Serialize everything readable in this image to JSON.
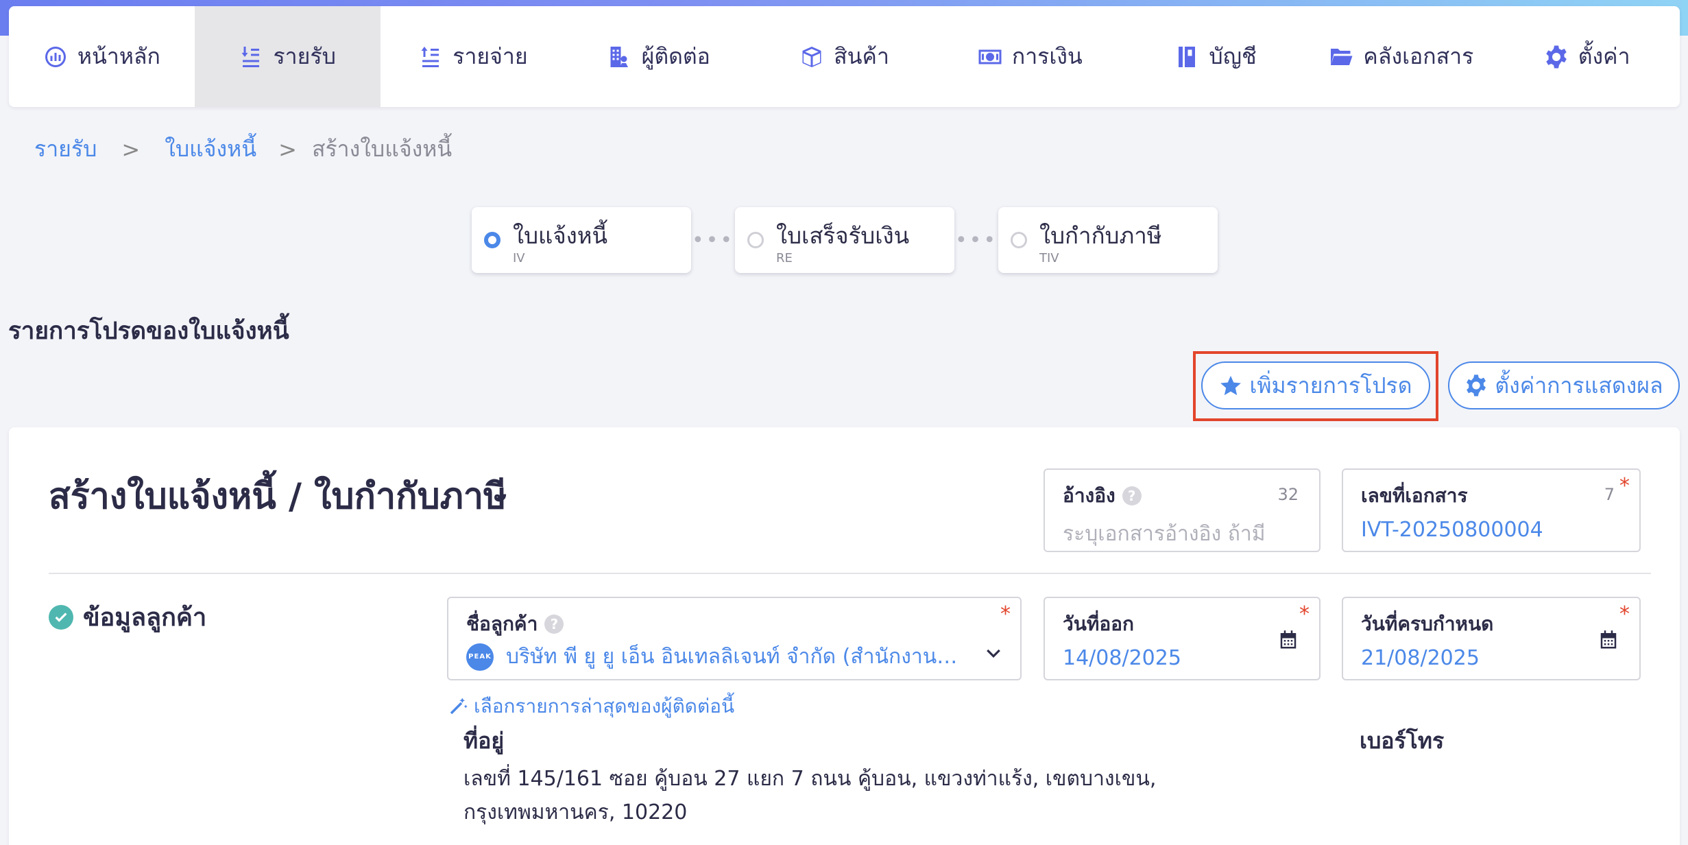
{
  "nav": {
    "items": [
      {
        "label": "หน้าหลัก",
        "icon": "dashboard-icon"
      },
      {
        "label": "รายรับ",
        "icon": "income-icon"
      },
      {
        "label": "รายจ่าย",
        "icon": "expense-icon"
      },
      {
        "label": "ผู้ติดต่อ",
        "icon": "contacts-icon"
      },
      {
        "label": "สินค้า",
        "icon": "box-icon"
      },
      {
        "label": "การเงิน",
        "icon": "money-icon"
      },
      {
        "label": "บัญชี",
        "icon": "ledger-icon"
      },
      {
        "label": "คลังเอกสาร",
        "icon": "folder-icon"
      },
      {
        "label": "ตั้งค่า",
        "icon": "gear-icon"
      }
    ],
    "active_index": 1
  },
  "breadcrumb": {
    "level1": "รายรับ",
    "level2": "ใบแจ้งหนี้",
    "current": "สร้างใบแจ้งหนี้",
    "separator": ">"
  },
  "steps": [
    {
      "title": "ใบแจ้งหนี้",
      "code": "IV"
    },
    {
      "title": "ใบเสร็จรับเงิน",
      "code": "RE"
    },
    {
      "title": "ใบกำกับภาษี",
      "code": "TIV"
    }
  ],
  "favorites": {
    "title": "รายการโปรดของใบแจ้งหนี้",
    "add_button": "เพิ่มรายการโปรด",
    "display_settings_button": "ตั้งค่าการแสดงผล"
  },
  "form": {
    "title": "สร้างใบแจ้งหนี้ / ใบกำกับภาษี",
    "reference": {
      "label": "อ้างอิง",
      "counter": "32",
      "placeholder": "ระบุเอกสารอ้างอิง ถ้ามี"
    },
    "doc_number": {
      "label": "เลขที่เอกสาร",
      "counter": "7",
      "value": "IVT-20250800004"
    },
    "customer_section_label": "ข้อมูลลูกค้า",
    "customer": {
      "label": "ชื่อลูกค้า",
      "value": "บริษัท พี ยู ยู เอ็น อินเทลลิเจนท์ จำกัด (สำนักงานใหญ่)",
      "logo_text": "PEAK"
    },
    "issue_date": {
      "label": "วันที่ออก",
      "value": "14/08/2025"
    },
    "due_date": {
      "label": "วันที่ครบกำหนด",
      "value": "21/08/2025"
    },
    "latest_contact_link": "เลือกรายการล่าสุดของผู้ติดต่อนี้",
    "address_label": "ที่อยู่",
    "address_value": "เลขที่ 145/161 ซอย คู้บอน 27 แยก 7 ถนน คู้บอน, แขวงท่าแร้ง, เขตบางเขน, กรุงเทพมหานคร, 10220",
    "phone_label": "เบอร์โทร",
    "required_mark": "*"
  },
  "colors": {
    "accent": "#4b88e8",
    "nav_icon": "#5b68e8",
    "required": "#e2452c",
    "highlight": "#e2452c",
    "success": "#4fb7b0"
  }
}
